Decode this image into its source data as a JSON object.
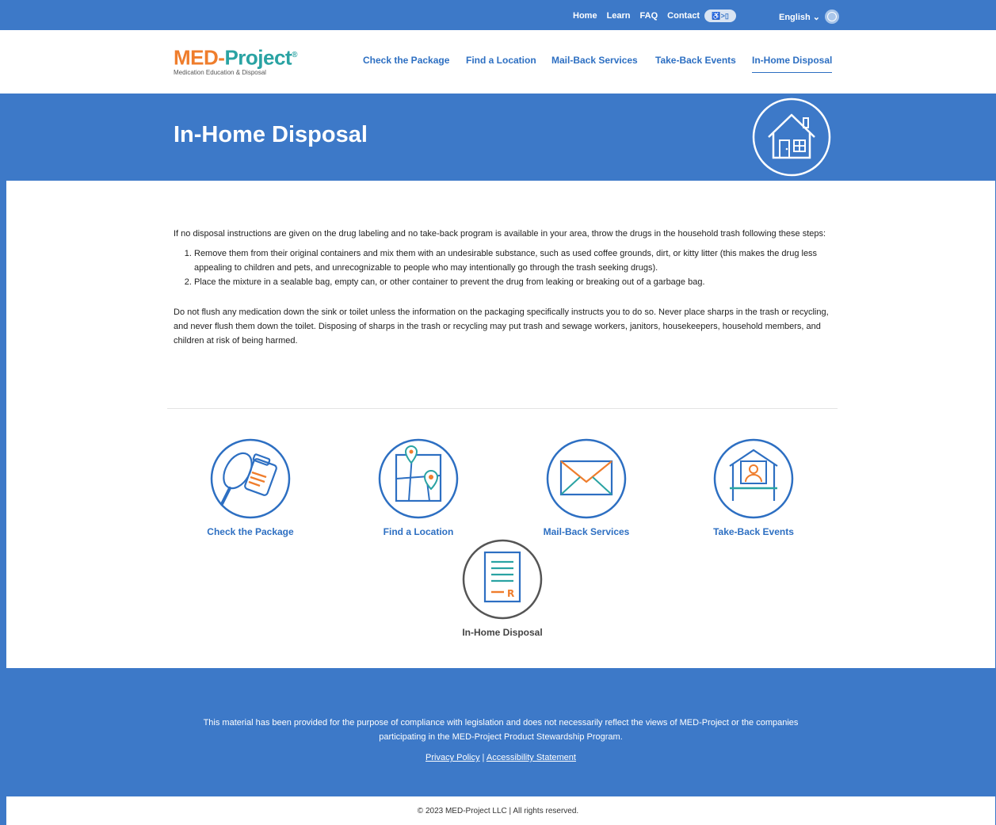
{
  "utility": {
    "links": [
      "Home",
      "Learn",
      "FAQ",
      "Contact"
    ],
    "accessibility_badge": "♿>▯",
    "language": "English ⌄"
  },
  "logo": {
    "part1": "MED-",
    "part2": "Project",
    "mark": "®",
    "subtitle": "Medication Education & Disposal"
  },
  "nav": {
    "items": [
      "Check the Package",
      "Find a Location",
      "Mail-Back Services",
      "Take-Back Events",
      "In-Home Disposal"
    ],
    "active": "In-Home Disposal"
  },
  "hero": {
    "title": "In-Home Disposal",
    "icon": "house-icon"
  },
  "content": {
    "intro": "If no disposal instructions are given on the drug labeling and no take-back program is available in your area, throw the drugs in the household trash following these steps:",
    "steps": [
      "Remove them from their original containers and mix them with an undesirable substance, such as used coffee grounds, dirt, or kitty litter (this makes the drug less appealing to children and pets, and unrecognizable to people who may intentionally go through the trash seeking drugs).",
      "Place the mixture in a sealable bag, empty can, or other container to prevent the drug from leaking or breaking out of a garbage bag."
    ],
    "warning": "Do not flush any medication down the sink or toilet unless the information on the packaging specifically instructs you to do so. Never place sharps in the trash or recycling, and never flush them down the toilet. Disposing of sharps in the trash or recycling may put trash and sewage workers, janitors, housekeepers, household members, and children at risk of being harmed."
  },
  "tiles": [
    {
      "label": "Check the Package",
      "icon": "magnifier-pill-bottle-icon"
    },
    {
      "label": "Find a Location",
      "icon": "map-pin-icon"
    },
    {
      "label": "Mail-Back Services",
      "icon": "envelope-icon"
    },
    {
      "label": "Take-Back Events",
      "icon": "booth-person-icon"
    },
    {
      "label": "In-Home Disposal",
      "icon": "prescription-document-icon"
    }
  ],
  "footer": {
    "disclaimer": "This material has been provided for the purpose of compliance with legislation and does not necessarily reflect the views of MED-Project or the companies participating in the MED-Project Product Stewardship Program.",
    "privacy": "Privacy Policy",
    "separator": "|",
    "accessibility": "Accessibility Statement",
    "copyright": "© 2023 MED-Project LLC | All rights reserved."
  },
  "colors": {
    "brand_blue": "#3d79c8",
    "link_blue": "#2d6fc2",
    "logo_orange": "#ef7d2c",
    "logo_teal": "#2aa3a3"
  }
}
